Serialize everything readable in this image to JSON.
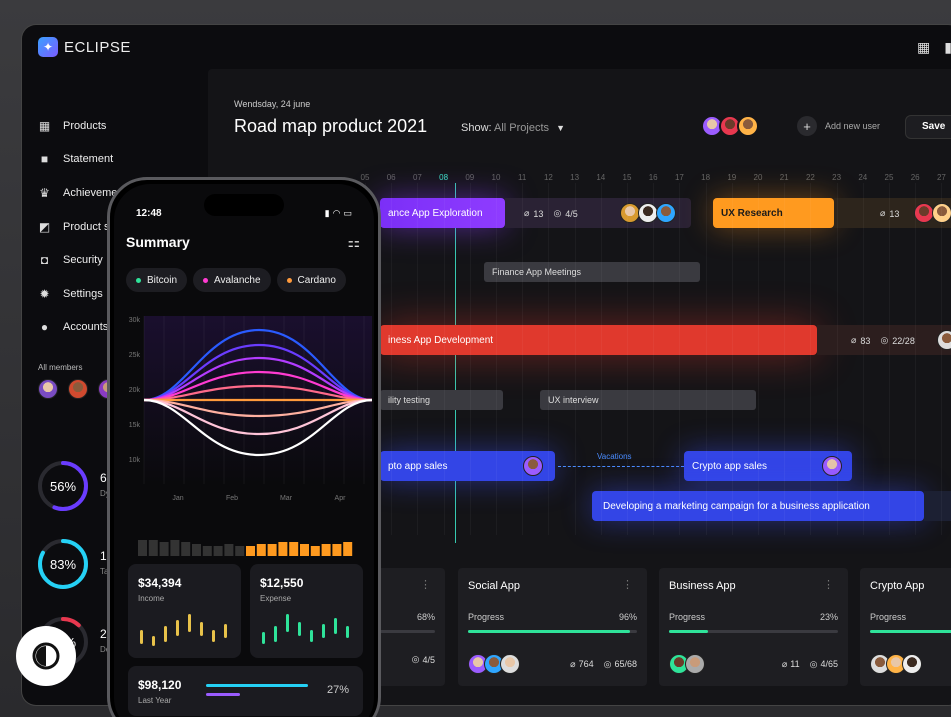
{
  "app": {
    "name": "ECLIPSE"
  },
  "sidebar": {
    "items": [
      {
        "label": "Products",
        "icon": "grid-icon"
      },
      {
        "label": "Statement",
        "icon": "bookmark-icon"
      },
      {
        "label": "Achievement",
        "icon": "crown-icon"
      },
      {
        "label": "Product s",
        "icon": "chart-icon"
      },
      {
        "label": "Security",
        "icon": "lock-icon"
      },
      {
        "label": "Settings",
        "icon": "gear-icon"
      },
      {
        "label": "Accounts",
        "icon": "user-icon"
      }
    ],
    "members_label": "All members",
    "stats": [
      {
        "percent": "56%",
        "value": "6",
        "sub": "Dy",
        "color": "#6a3cff",
        "fraction": 0.56
      },
      {
        "percent": "83%",
        "value": "13",
        "sub": "Ta",
        "color": "#25d1f5",
        "fraction": 0.83
      },
      {
        "percent": "12%",
        "value": "2",
        "sub": "De",
        "color": "#e8384f",
        "fraction": 0.12
      }
    ]
  },
  "header": {
    "date": "Wendsday, 24 june",
    "title": "Road map product 2021",
    "show_label": "Show:",
    "show_value": "All Projects",
    "add_user": "Add new user",
    "save": "Save"
  },
  "timeline": {
    "days": [
      "05",
      "06",
      "07",
      "08",
      "09",
      "10",
      "11",
      "12",
      "13",
      "14",
      "15",
      "16",
      "17",
      "18",
      "19",
      "20",
      "21",
      "22",
      "23",
      "24",
      "25",
      "26",
      "27"
    ],
    "active_day": "08"
  },
  "bars": {
    "finance_exploration": {
      "label": "ance App Exploration",
      "attach": "13",
      "tasks": "4/5"
    },
    "ux_research": {
      "label": "UX Research",
      "attach": "13"
    },
    "finance_meetings": {
      "label": "Finance App Meetings"
    },
    "business_dev": {
      "label": "iness App Development",
      "attach": "83",
      "tasks": "22/28"
    },
    "usability": {
      "label": "ility testing"
    },
    "ux_interview": {
      "label": "UX interview"
    },
    "crypto_sales_1": {
      "label": "pto app sales"
    },
    "vacations": {
      "label": "Vacations"
    },
    "crypto_sales_2": {
      "label": "Crypto app sales"
    },
    "marketing": {
      "label": "Developing a marketing campaign for a business application"
    }
  },
  "cards": [
    {
      "title": "",
      "progress": "68%",
      "fraction": 0.68,
      "attach": "",
      "tasks": "4/5"
    },
    {
      "title": "Social App",
      "progress": "96%",
      "fraction": 0.96,
      "attach": "764",
      "tasks": "65/68"
    },
    {
      "title": "Business App",
      "progress": "23%",
      "fraction": 0.23,
      "attach": "11",
      "tasks": "4/65"
    },
    {
      "title": "Crypto App",
      "progress": "",
      "fraction": 0.98,
      "attach": "",
      "tasks": ""
    }
  ],
  "card_progress_label": "Progress",
  "phone": {
    "time": "12:48",
    "title": "Summary",
    "chips": [
      {
        "label": "Bitcoin",
        "color": "#2fe39a"
      },
      {
        "label": "Avalanche",
        "color": "#ff3bd1"
      },
      {
        "label": "Cardano",
        "color": "#ff9a3c"
      }
    ],
    "chart_y_ticks": [
      "30k",
      "25k",
      "20k",
      "15k",
      "10k"
    ],
    "chart_x_ticks": [
      "Jan",
      "Feb",
      "Mar",
      "Apr"
    ],
    "income": {
      "value": "$34,394",
      "label": "Income"
    },
    "expense": {
      "value": "$12,550",
      "label": "Expense"
    },
    "last_year": {
      "value": "$98,120",
      "label": "Last Year",
      "percent": "27%"
    }
  }
}
